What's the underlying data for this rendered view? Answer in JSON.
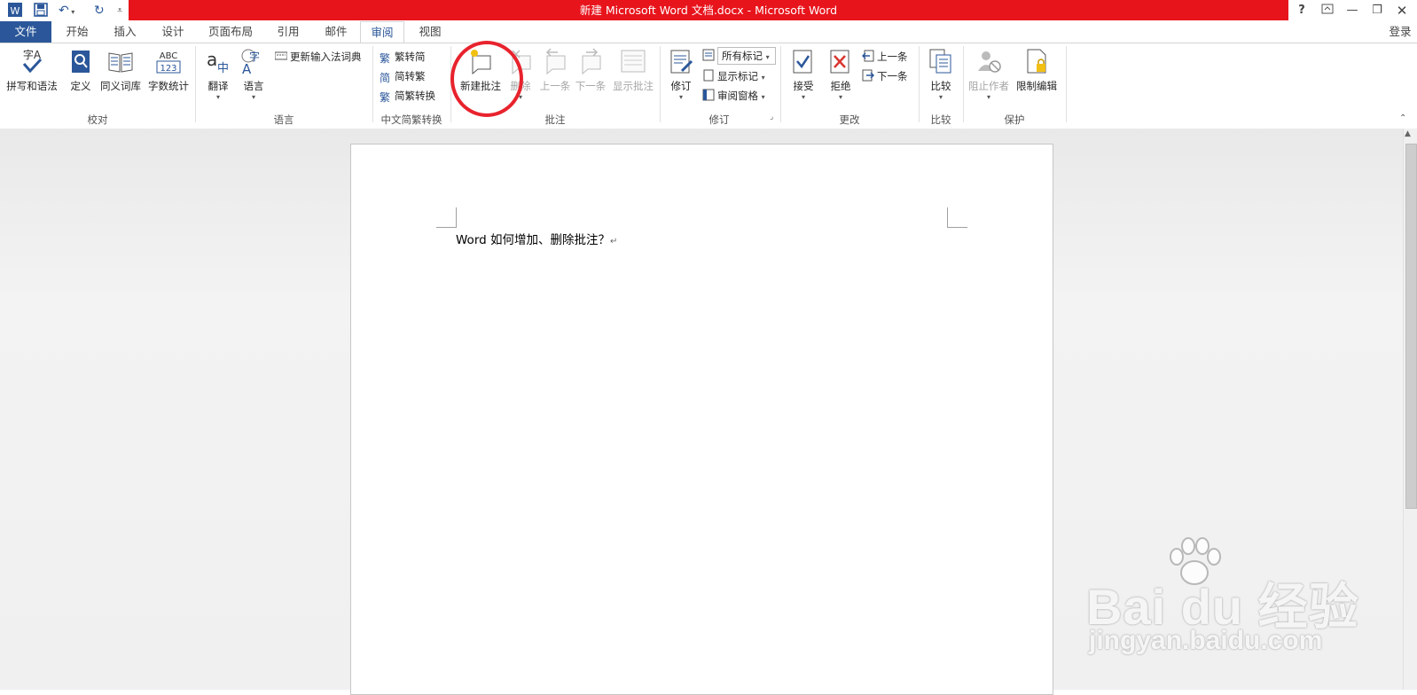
{
  "window": {
    "title": "新建 Microsoft Word 文档.docx -  Microsoft Word",
    "help": "?",
    "sign_in": "登录"
  },
  "tabs": [
    "开始",
    "插入",
    "设计",
    "页面布局",
    "引用",
    "邮件",
    "审阅",
    "视图"
  ],
  "file_tab": "文件",
  "active_tab": "审阅",
  "ribbon": {
    "proofing": {
      "label": "校对",
      "spelling": "拼写和语法",
      "define": "定义",
      "thesaurus": "同义词库",
      "word_count": "字数统计",
      "spelling_icon_text": "字A",
      "word_count_icon_text": "ABC\n123"
    },
    "language": {
      "label": "语言",
      "translate": "翻译",
      "language": "语言",
      "update_ime": "更新输入法词典"
    },
    "chinese_conversion": {
      "label": "中文简繁转换",
      "to_simplified": "繁转简",
      "to_traditional": "简转繁",
      "convert": "简繁转换"
    },
    "comments": {
      "label": "批注",
      "new": "新建批注",
      "delete": "删除",
      "previous": "上一条",
      "next": "下一条",
      "show": "显示批注"
    },
    "tracking": {
      "label": "修订",
      "track": "修订",
      "markup_select": "所有标记",
      "show_markup": "显示标记",
      "reviewing_pane": "审阅窗格"
    },
    "changes": {
      "label": "更改",
      "accept": "接受",
      "reject": "拒绝",
      "previous": "上一条",
      "next": "下一条"
    },
    "compare": {
      "label": "比较",
      "compare": "比较"
    },
    "protect": {
      "label": "保护",
      "block_authors": "阻止作者",
      "restrict": "限制编辑"
    }
  },
  "document": {
    "text": "Word 如何增加、删除批注？",
    "para_mark": "↵"
  },
  "watermark": {
    "brand": "Bai du 经验",
    "url": "jingyan.baidu.com"
  },
  "colors": {
    "title_red": "#e8141c",
    "word_blue": "#2b579a",
    "highlight": "#e8232d"
  }
}
